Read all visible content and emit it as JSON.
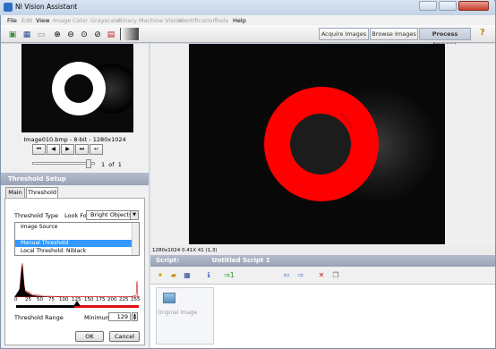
{
  "window": {
    "title": "NI Vision Assistant"
  },
  "menu": [
    "File",
    "Edit",
    "View",
    "Image",
    "Color",
    "Grayscale",
    "Binary",
    "Machine Vision",
    "Identification",
    "Tools",
    "Help"
  ],
  "mode_tabs": [
    "Acquire Images",
    "Browse Images",
    "Process Images"
  ],
  "thumbnail": {
    "info": "Image010.bmp - 8-bit - 1280x1024",
    "page": "1",
    "of": "of",
    "total": "1"
  },
  "threshold_setup": {
    "header": "Threshold Setup",
    "tabs": [
      "Main",
      "Threshold"
    ],
    "type_label": "Threshold Type",
    "look_for_label": "Look For",
    "look_for_value": "Bright Objects",
    "list": [
      "Image Source",
      "",
      "Manual Threshold",
      "Local Threshold: Niblack"
    ],
    "hist_ticks": [
      "0",
      "25",
      "50",
      "75",
      "100",
      "125",
      "150",
      "175",
      "200",
      "225",
      "255"
    ],
    "range_label": "Threshold Range",
    "minimum_label": "Minimum",
    "minimum_value": "129",
    "ok": "OK",
    "cancel": "Cancel"
  },
  "status": {
    "text": "1280x1024 0.41X 41   (1,3)"
  },
  "script": {
    "label": "Script:",
    "name": "Untitled Script 1",
    "step": "Original Image"
  },
  "colors": {
    "accent": "#e01010",
    "selection": "#3399ff",
    "header": "#98a3b6"
  }
}
